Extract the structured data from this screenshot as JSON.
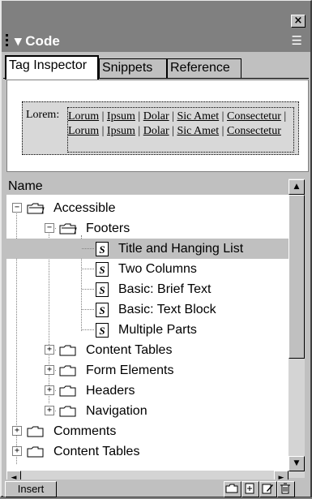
{
  "panel": {
    "close_label": "×",
    "title": "Code",
    "collapse_glyph": "▾",
    "options_glyph": "☰"
  },
  "tabs": [
    {
      "label": "Tag Inspector",
      "active": true
    },
    {
      "label": "Snippets",
      "active": false
    },
    {
      "label": "Reference",
      "active": false
    }
  ],
  "inspector": {
    "tag": "Lorem:",
    "links": [
      "Lorum",
      "Ipsum",
      "Dolar",
      "Sic Amet",
      "Consectetur",
      "Lorum",
      "Ipsum",
      "Dolar",
      "Sic Amet",
      "Consectetur"
    ]
  },
  "list": {
    "header": "Name",
    "rows": [
      {
        "label": "Accessible",
        "type": "folder",
        "depth": 0,
        "expander": "−"
      },
      {
        "label": "Footers",
        "type": "folder",
        "depth": 1,
        "expander": "−"
      },
      {
        "label": "Title and Hanging List",
        "type": "snippet",
        "depth": 2,
        "selected": true
      },
      {
        "label": "Two Columns",
        "type": "snippet",
        "depth": 2
      },
      {
        "label": "Basic: Brief Text",
        "type": "snippet",
        "depth": 2
      },
      {
        "label": "Basic: Text Block",
        "type": "snippet",
        "depth": 2
      },
      {
        "label": "Multiple Parts",
        "type": "snippet",
        "depth": 2
      },
      {
        "label": "Content Tables",
        "type": "folder",
        "depth": 1,
        "expander": "+"
      },
      {
        "label": "Form Elements",
        "type": "folder",
        "depth": 1,
        "expander": "+"
      },
      {
        "label": "Headers",
        "type": "folder",
        "depth": 1,
        "expander": "+"
      },
      {
        "label": "Navigation",
        "type": "folder",
        "depth": 1,
        "expander": "+"
      },
      {
        "label": "Comments",
        "type": "folder",
        "depth": 0,
        "expander": "+"
      },
      {
        "label": "Content Tables",
        "type": "folder",
        "depth": 0,
        "expander": "+"
      }
    ],
    "snippet_glyph": "S"
  },
  "scroll": {
    "up": "▲",
    "down": "▼",
    "left": "◄",
    "right": "►"
  },
  "footer": {
    "insert_label": "Insert",
    "buttons": [
      "new-folder-icon",
      "new-snippet-icon",
      "edit-snippet-icon",
      "delete-icon"
    ]
  },
  "colors": {
    "panel": "#c0c0c0",
    "dark": "#808080",
    "selected": "#c0c0c0"
  }
}
